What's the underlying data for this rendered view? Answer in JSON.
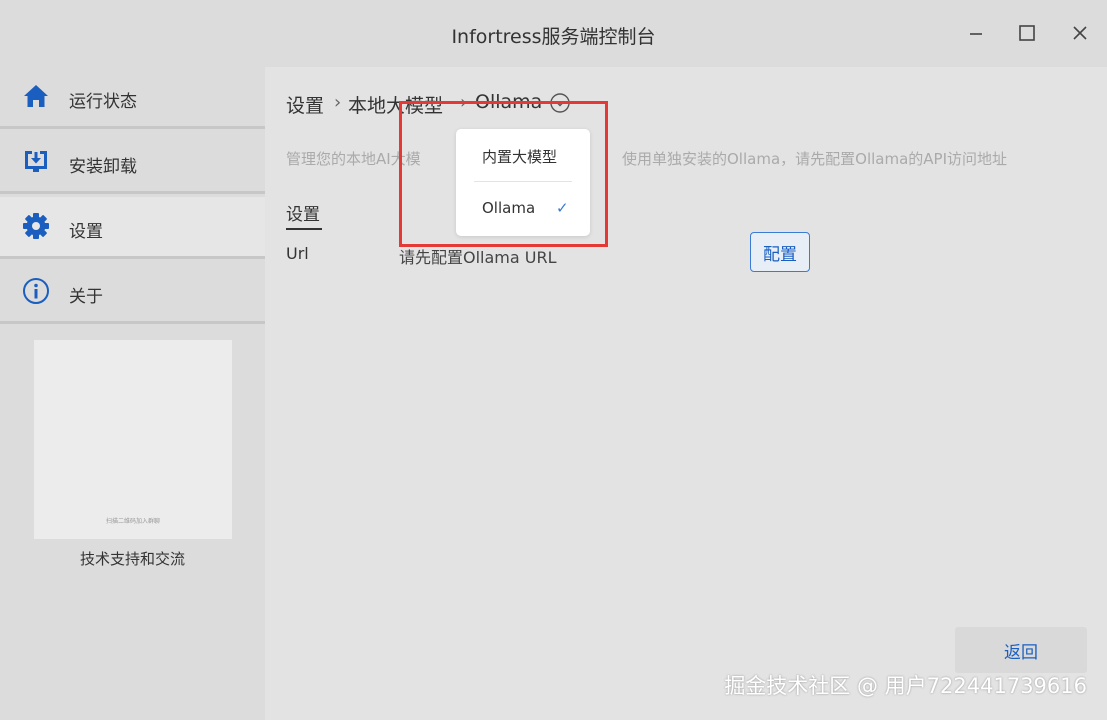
{
  "window": {
    "title": "Infortress服务端控制台",
    "controls": {
      "minimize": "—",
      "maximize": "☐",
      "close": "✕"
    }
  },
  "sidebar": {
    "items": [
      {
        "label": "运行状态",
        "icon": "home-icon",
        "active": false
      },
      {
        "label": "安装卸载",
        "icon": "download-install-icon",
        "active": false
      },
      {
        "label": "设置",
        "icon": "gear-icon",
        "active": true
      },
      {
        "label": "关于",
        "icon": "info-icon",
        "active": false
      }
    ],
    "qr_caption": "扫描二维码加入群聊",
    "support_label": "技术支持和交流"
  },
  "main": {
    "breadcrumb": {
      "root": "设置",
      "sep": "›",
      "level1": "本地大模型",
      "level2": "Ollama"
    },
    "description": {
      "part1": "管理您的本地AI大模",
      "part2": "使用单独安装的Ollama，请先配置Ollama的API访问地址"
    },
    "tab_label": "设置",
    "row": {
      "label": "Url",
      "value": "请先配置Ollama URL"
    },
    "config_button": "配置",
    "back_button": "返回"
  },
  "dropdown": {
    "options": [
      {
        "label": "内置大模型",
        "selected": false
      },
      {
        "label": "Ollama",
        "selected": true
      }
    ],
    "check": "✓"
  },
  "colors": {
    "accent": "#1a5fc0",
    "highlight": "#e53935"
  },
  "watermark": "掘金技术社区 @ 用户722441739616"
}
